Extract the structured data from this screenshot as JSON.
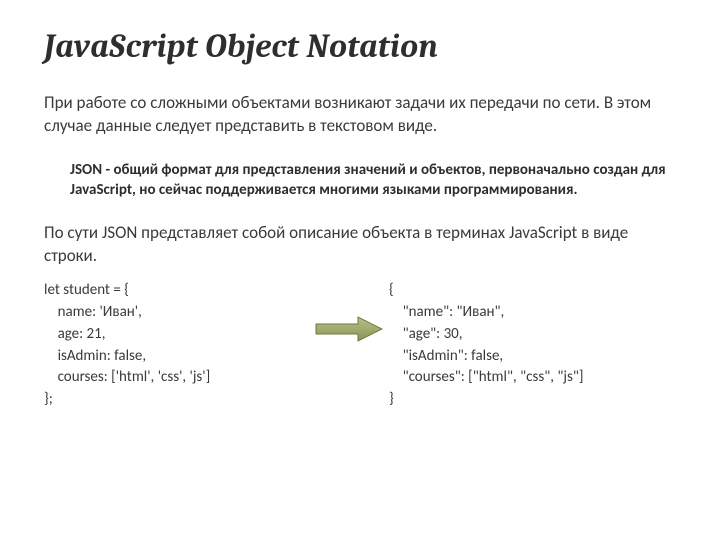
{
  "title": "JavaScript Object Notation",
  "intro": "При работе со сложными объектами возникают задачи их передачи по сети. В этом случае данные следует представить в текстовом виде.",
  "callout": "JSON - общий формат для представления значений и объектов, первоначально создан для JavaScript, но сейчас поддерживается многими языками программирования.",
  "summary": "По сути JSON представляет собой описание объекта в терминах JavaScript в виде строки.",
  "code_left": "let student = {\n    name: 'Иван',\n    age: 21,\n    isAdmin: false,\n    courses: ['html', 'css', 'js']\n};",
  "code_right": "{\n    \"name\": \"Иван\",\n    \"age\": 30,\n    \"isAdmin\": false,\n    \"courses\": [\"html\", \"css\", \"js\"]\n}"
}
